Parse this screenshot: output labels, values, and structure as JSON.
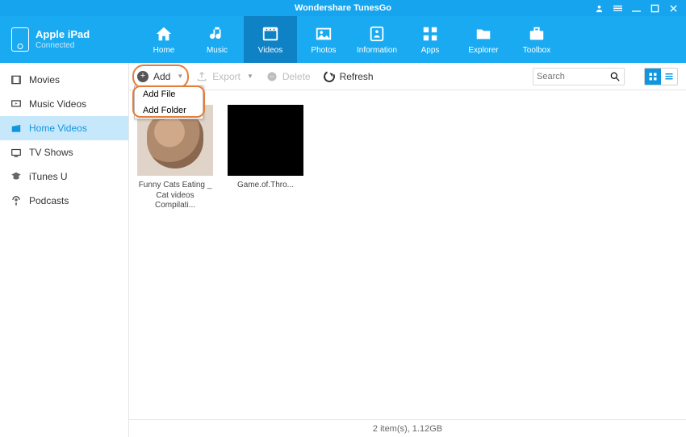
{
  "app_title": "Wondershare TunesGo",
  "device": {
    "name": "Apple iPad",
    "status": "Connected"
  },
  "nav": [
    {
      "label": "Home"
    },
    {
      "label": "Music"
    },
    {
      "label": "Videos"
    },
    {
      "label": "Photos"
    },
    {
      "label": "Information"
    },
    {
      "label": "Apps"
    },
    {
      "label": "Explorer"
    },
    {
      "label": "Toolbox"
    }
  ],
  "sidebar": [
    {
      "label": "Movies"
    },
    {
      "label": "Music Videos"
    },
    {
      "label": "Home Videos"
    },
    {
      "label": "TV Shows"
    },
    {
      "label": "iTunes U"
    },
    {
      "label": "Podcasts"
    }
  ],
  "toolbar": {
    "add": "Add",
    "export": "Export",
    "delete": "Delete",
    "refresh": "Refresh",
    "search_placeholder": "Search"
  },
  "dropdown": {
    "add_file": "Add File",
    "add_folder": "Add Folder"
  },
  "items": [
    {
      "label": "Funny Cats Eating _ Cat videos Compilati..."
    },
    {
      "label": "Game.of.Thro..."
    }
  ],
  "status": "2 item(s), 1.12GB"
}
